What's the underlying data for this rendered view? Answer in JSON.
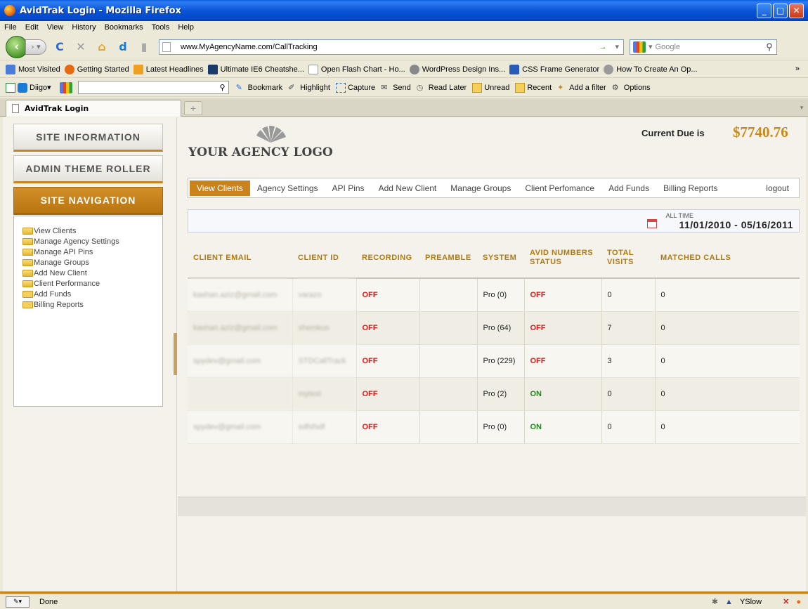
{
  "window": {
    "title": "AvidTrak Login - Mozilla Firefox"
  },
  "menubar": [
    "File",
    "Edit",
    "View",
    "History",
    "Bookmarks",
    "Tools",
    "Help"
  ],
  "navbar": {
    "url": "www.MyAgencyName.com/CallTracking",
    "search_placeholder": "Google"
  },
  "bookmarks": [
    {
      "label": "Most Visited",
      "color": "#4a7cd8"
    },
    {
      "label": "Getting Started",
      "color": "#e86a10"
    },
    {
      "label": "Latest Headlines",
      "color": "#f0a020"
    },
    {
      "label": "Ultimate IE6 Cheatshe...",
      "color": "#1a3a6a"
    },
    {
      "label": "Open Flash Chart - Ho...",
      "color": "#dddddd"
    },
    {
      "label": "WordPress Design Ins...",
      "color": "#888888"
    },
    {
      "label": "CSS Frame Generator",
      "color": "#2a5ab8"
    },
    {
      "label": "How To Create An Op...",
      "color": "#9a9a9a"
    }
  ],
  "diigo": {
    "brand": "Diigo",
    "tools": [
      "Bookmark",
      "Highlight",
      "Capture",
      "Send",
      "Read Later",
      "Unread",
      "Recent",
      "Add a filter",
      "Options"
    ]
  },
  "tab": {
    "title": "AvidTrak Login"
  },
  "sidebar": {
    "buttons": [
      "SITE INFORMATION",
      "ADMIN THEME ROLLER",
      "SITE NAVIGATION"
    ],
    "nav_items": [
      {
        "label": "View Clients",
        "open": true
      },
      {
        "label": "Manage Agency Settings",
        "open": true
      },
      {
        "label": "Manage API Pins",
        "open": true
      },
      {
        "label": "Manage Groups",
        "open": true
      },
      {
        "label": "Add New Client",
        "open": true
      },
      {
        "label": "Client Performance",
        "open": true
      },
      {
        "label": "Add Funds",
        "open": false
      },
      {
        "label": "Billing Reports",
        "open": false
      }
    ]
  },
  "header": {
    "logo_text": "YOUR AGENCY LOGO",
    "due_label": "Current Due is",
    "due_amount": "$7740.76"
  },
  "menu": {
    "items": [
      "View Clients",
      "Agency Settings",
      "API Pins",
      "Add New Client",
      "Manage Groups",
      "Client Perfomance",
      "Add Funds",
      "Billing Reports"
    ],
    "active": "View Clients",
    "logout": "logout"
  },
  "daterange": {
    "label": "ALL TIME",
    "value": "11/01/2010 - 05/16/2011"
  },
  "table": {
    "headers": [
      "CLIENT EMAIL",
      "CLIENT ID",
      "RECORDING",
      "PREAMBLE",
      "SYSTEM",
      "AVID NUMBERS STATUS",
      "TOTAL VISITS",
      "MATCHED CALLS"
    ],
    "rows": [
      {
        "email": "kashan.aziz@gmail.com",
        "id": "varazo",
        "recording": "OFF",
        "preamble": "",
        "system": "Pro (0)",
        "status": "OFF",
        "visits": "0",
        "calls": "0"
      },
      {
        "email": "kashan.aziz@gmail.com",
        "id": "shemkus",
        "recording": "OFF",
        "preamble": "",
        "system": "Pro (64)",
        "status": "OFF",
        "visits": "7",
        "calls": "0"
      },
      {
        "email": "spydev@gmail.com",
        "id": "STDCallTrack",
        "recording": "OFF",
        "preamble": "",
        "system": "Pro (229)",
        "status": "OFF",
        "visits": "3",
        "calls": "0"
      },
      {
        "email": "",
        "id": "mytest",
        "recording": "OFF",
        "preamble": "",
        "system": "Pro (2)",
        "status": "ON",
        "visits": "0",
        "calls": "0"
      },
      {
        "email": "spydev@gmail.com",
        "id": "sdfsfsdf",
        "recording": "OFF",
        "preamble": "",
        "system": "Pro (0)",
        "status": "ON",
        "visits": "0",
        "calls": "0"
      }
    ]
  },
  "statusbar": {
    "text": "Done",
    "yslow": "YSlow"
  },
  "colors": {
    "accent": "#c8841a",
    "off": "#dd1a1a",
    "on": "#1c8a1c"
  }
}
